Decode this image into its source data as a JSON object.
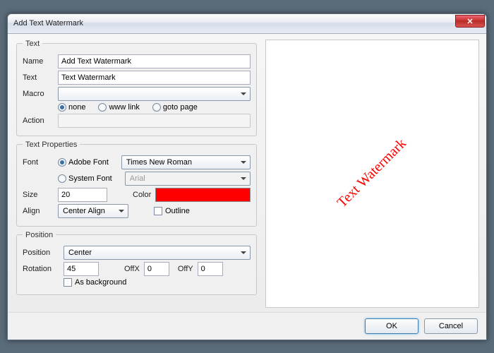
{
  "window": {
    "title": "Add Text Watermark"
  },
  "groups": {
    "text": "Text",
    "props": "Text Properties",
    "position": "Position"
  },
  "text": {
    "name_label": "Name",
    "name_value": "Add Text Watermark",
    "text_label": "Text",
    "text_value": "Text Watermark",
    "macro_label": "Macro",
    "macro_value": "",
    "action_label": "Action",
    "radios": {
      "none": "none",
      "www": "www link",
      "goto": "goto page"
    }
  },
  "props": {
    "font_label": "Font",
    "adobe_label": "Adobe Font",
    "system_label": "System Font",
    "adobe_value": "Times New Roman",
    "system_value": "Arial",
    "size_label": "Size",
    "size_value": "20",
    "color_label": "Color",
    "color_value": "#ff0000",
    "align_label": "Align",
    "align_value": "Center Align",
    "outline_label": "Outline"
  },
  "position": {
    "position_label": "Position",
    "position_value": "Center",
    "rotation_label": "Rotation",
    "rotation_value": "45",
    "offx_label": "OffX",
    "offx_value": "0",
    "offy_label": "OffY",
    "offy_value": "0",
    "asbg_label": "As background"
  },
  "footer": {
    "ok": "OK",
    "cancel": "Cancel"
  },
  "preview": {
    "text": "Text Watermark"
  }
}
